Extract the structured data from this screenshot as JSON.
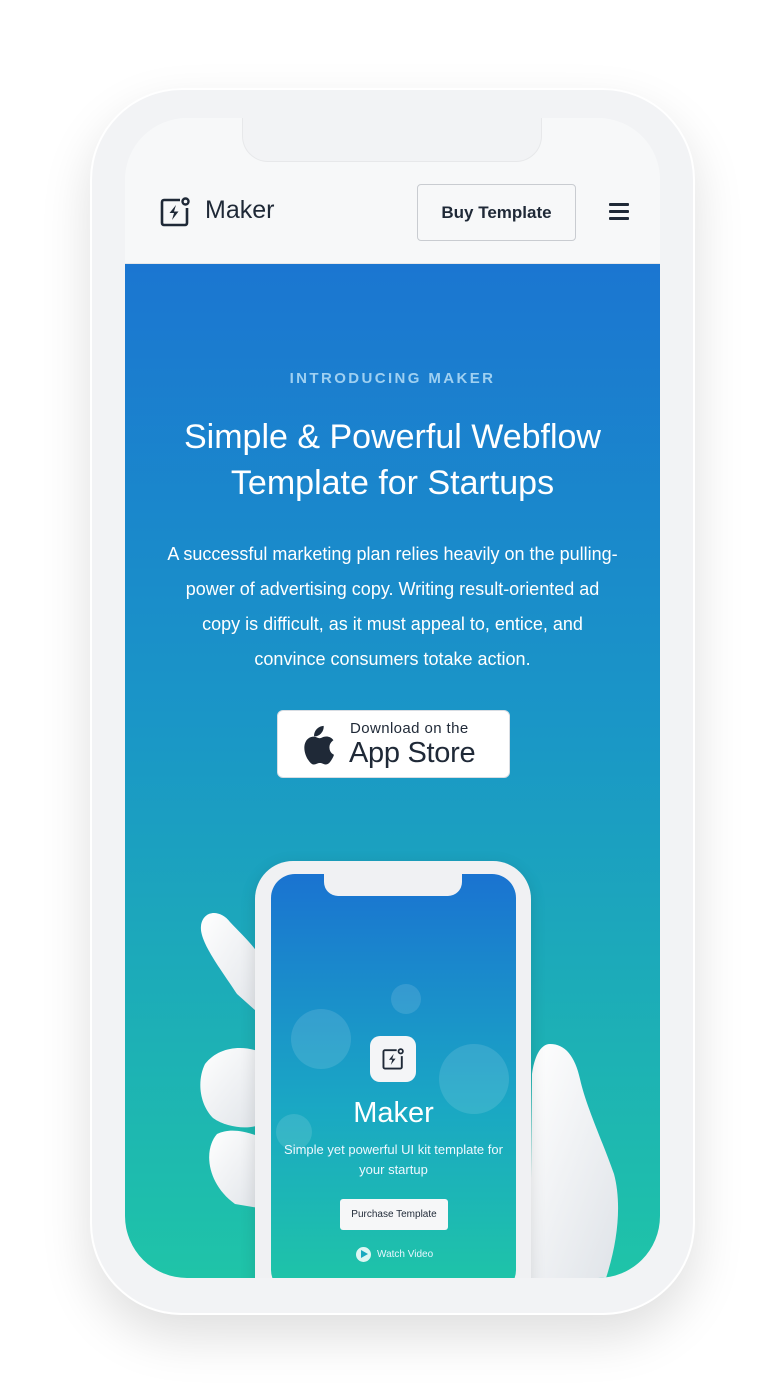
{
  "navbar": {
    "brand": "Maker",
    "buy_button": "Buy Template",
    "logo_icon": "lightning-square-icon",
    "menu_icon": "hamburger-menu-icon"
  },
  "hero": {
    "eyebrow": "INTRODUCING MAKER",
    "title": "Simple & Powerful Webflow Template for Startups",
    "description": "A successful marketing plan relies heavily on the pulling-power of advertising copy. Writing result-oriented ad copy is difficult, as it must appeal to, entice, and convince consumers totake action.",
    "app_store": {
      "small_text": "Download on the",
      "big_text": "App Store",
      "icon": "apple-icon"
    }
  },
  "mockup": {
    "title": "Maker",
    "subtitle": "Simple yet powerful UI kit template for your startup",
    "purchase_button": "Purchase Template",
    "watch_video": "Watch Video"
  },
  "colors": {
    "gradient_top": "#1b76d1",
    "gradient_bottom": "#1fc4a8",
    "text_dark": "#1f2937"
  }
}
